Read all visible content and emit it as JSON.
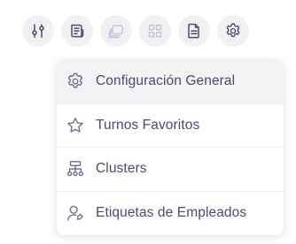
{
  "toolbar": {
    "buttons": [
      {
        "icon": "sliders-icon",
        "enabled": true
      },
      {
        "icon": "document-stack-icon",
        "enabled": true
      },
      {
        "icon": "copy-layers-icon",
        "enabled": false
      },
      {
        "icon": "grid-icon",
        "enabled": false
      },
      {
        "icon": "document-icon",
        "enabled": true
      },
      {
        "icon": "gear-icon",
        "enabled": true
      }
    ]
  },
  "colors": {
    "icon_active": "#4a4c6a",
    "icon_disabled": "#c5c6d3",
    "button_bg": "#f1f1f4",
    "menu_active_bg": "#f3f3f6",
    "menu_icon": "#6b6e8c"
  },
  "menu": {
    "items": [
      {
        "label": "Configuración General",
        "icon": "gear-icon",
        "active": true
      },
      {
        "label": "Turnos Favoritos",
        "icon": "star-icon",
        "active": false
      },
      {
        "label": "Clusters",
        "icon": "hierarchy-icon",
        "active": false
      },
      {
        "label": "Etiquetas de Empleados",
        "icon": "user-tag-icon",
        "active": false
      }
    ]
  }
}
